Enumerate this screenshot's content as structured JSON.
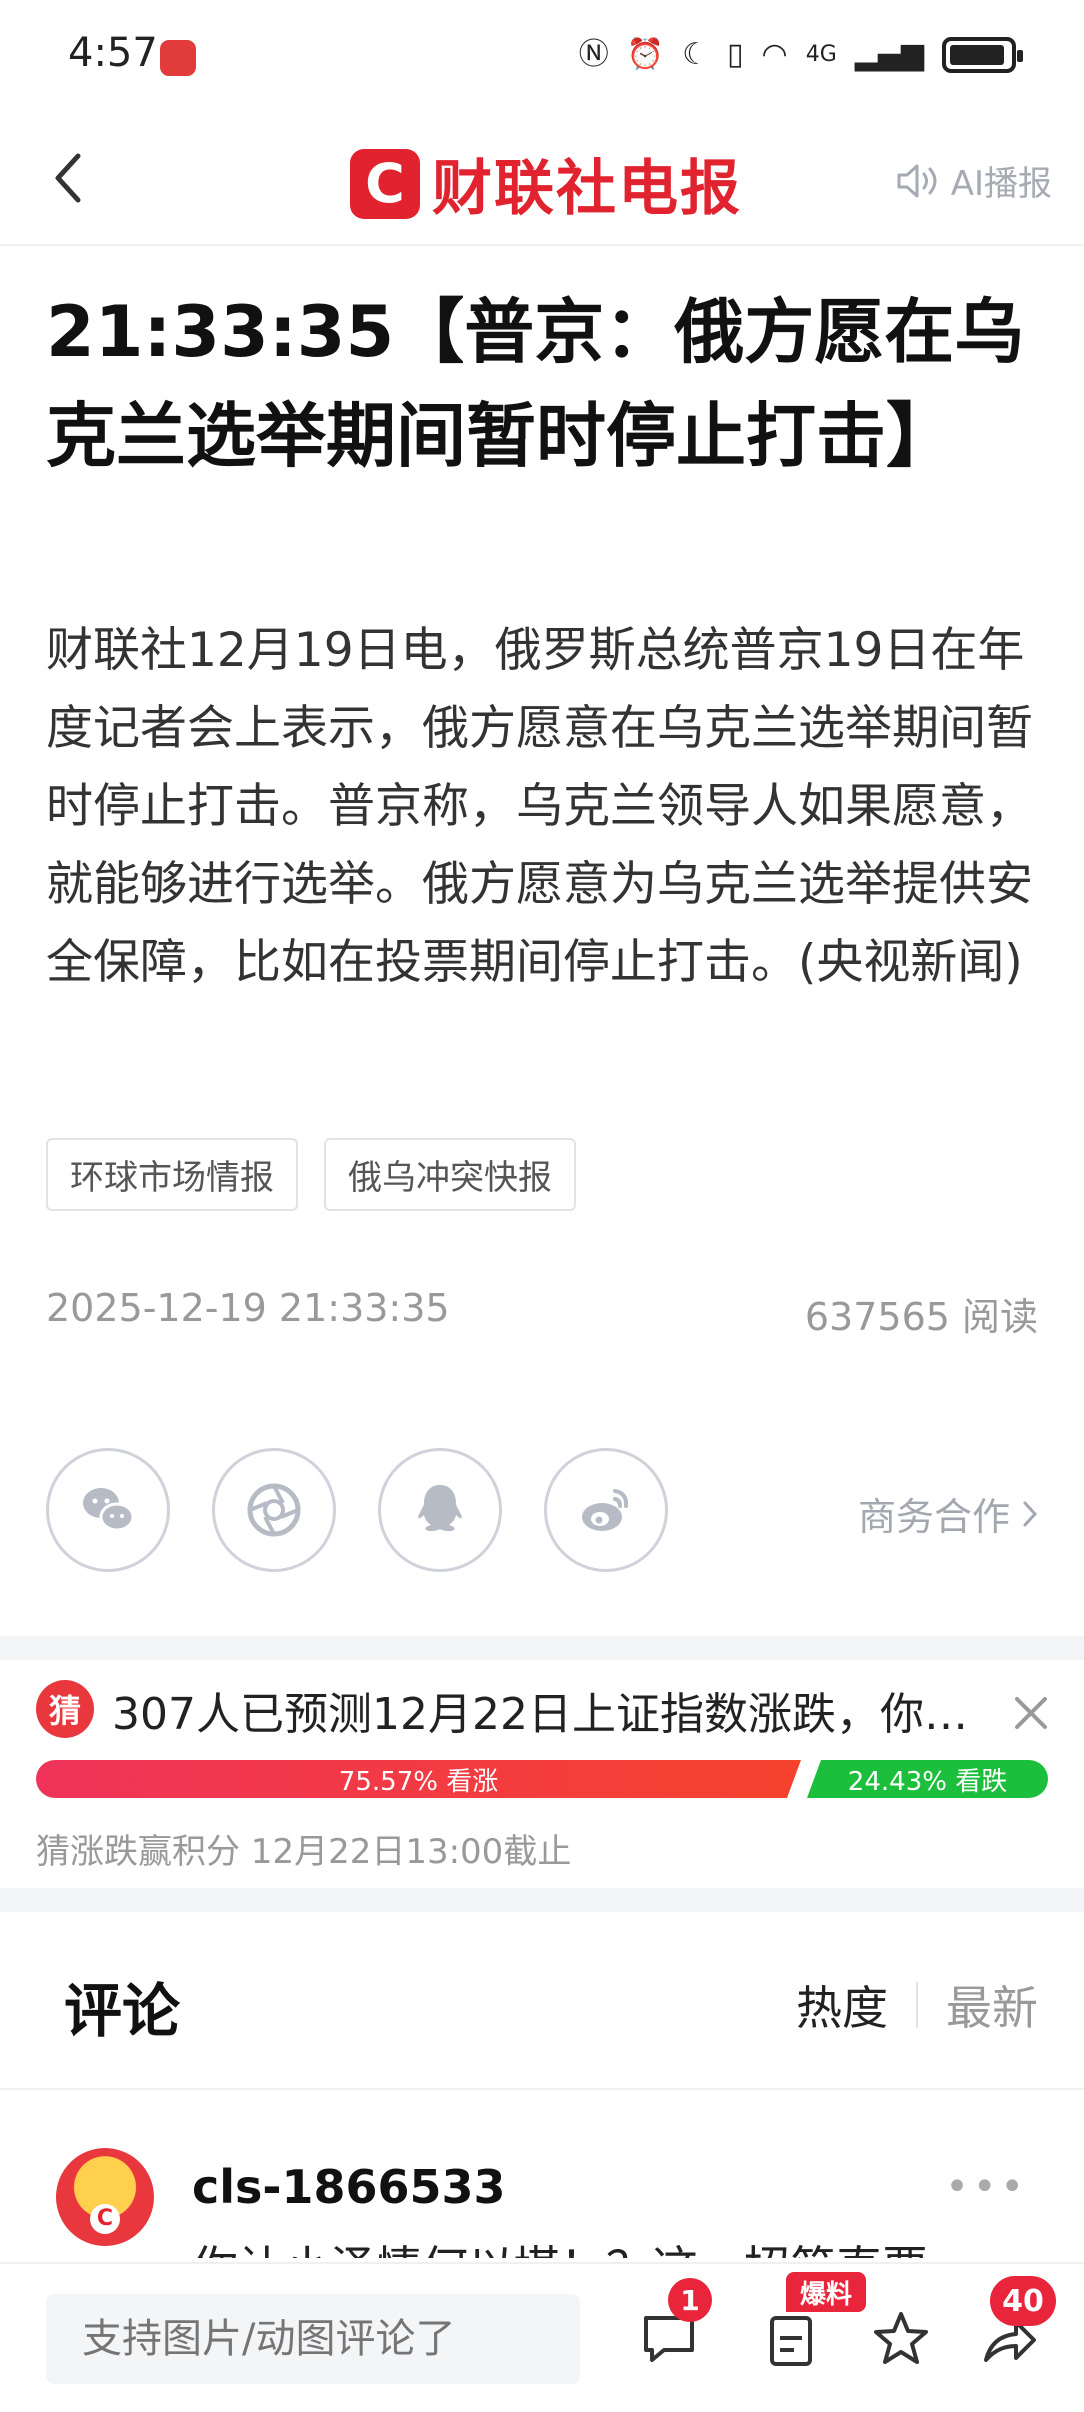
{
  "status_bar": {
    "time": "4:57",
    "network": "4G"
  },
  "header": {
    "brand_logo_letter": "C",
    "brand_name": "财联社电报",
    "ai_label": "AI播报"
  },
  "article": {
    "title": "21:33:35【普京：俄方愿在乌克兰选举期间暂时停止打击】",
    "body": "财联社12月19日电，俄罗斯总统普京19日在年度记者会上表示，俄方愿意在乌克兰选举期间暂时停止打击。普京称，乌克兰领导人如果愿意，就能够进行选举。俄方愿意为乌克兰选举提供安全保障，比如在投票期间停止打击。(央视新闻)",
    "tags": [
      "环球市场情报",
      "俄乌冲突快报"
    ],
    "date": "2025-12-19 21:33:35",
    "reads": "637565 阅读"
  },
  "share": {
    "icons": [
      "wechat-icon",
      "moments-icon",
      "qq-icon",
      "weibo-icon"
    ],
    "business_label": "商务合作"
  },
  "prediction": {
    "badge": "猜",
    "text": "307人已预测12月22日上证指数涨跌，你…",
    "up_fraction": 0.7557,
    "up_label": "75.57% 看涨",
    "down_label": "24.43% 看跌",
    "footer": "猜涨跌赢积分  12月22日13:00截止"
  },
  "comments": {
    "title": "评论",
    "sort_hot": "热度",
    "sort_new": "最新",
    "first": {
      "user": "cls-1866533",
      "text": "你让小泽情何以堪！？这一招简直要"
    }
  },
  "bottom_bar": {
    "input_placeholder": "支持图片/动图评论了",
    "comment_count": "1",
    "report_label": "爆料",
    "share_count": "40"
  },
  "colors": {
    "brand_red": "#e0232e",
    "up": "#f0335a",
    "down": "#1cbf3c"
  }
}
